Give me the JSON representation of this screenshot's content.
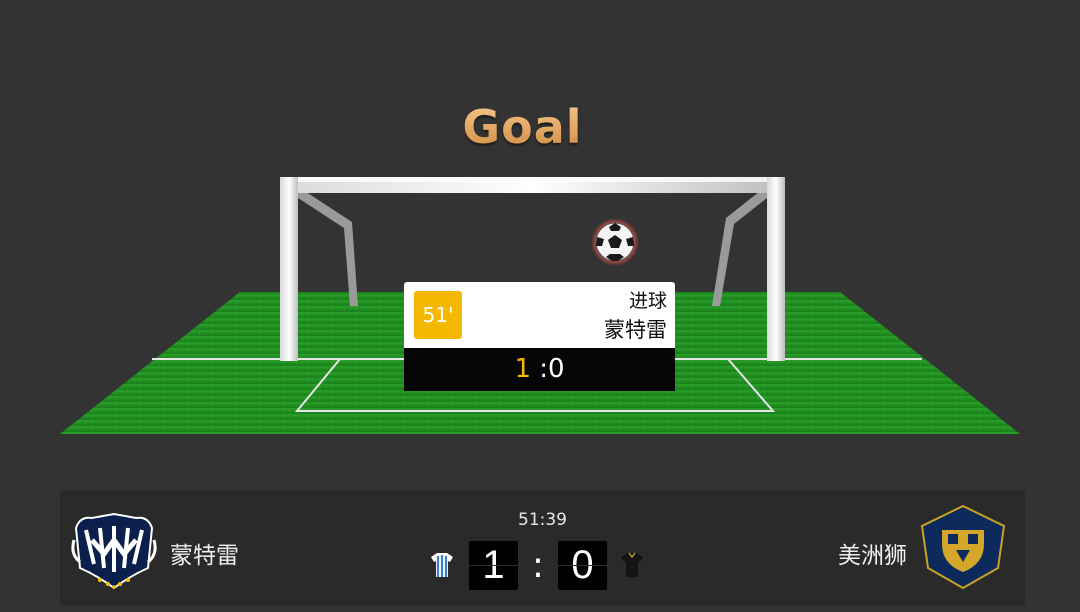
{
  "animation": {
    "title": "Goal",
    "event": {
      "minute": "51'",
      "type": "进球",
      "team": "蒙特雷",
      "score_scorer": "1",
      "score_rest": " :0"
    }
  },
  "scoreboard": {
    "clock": "51:39",
    "home": {
      "name": "蒙特雷",
      "score": "1",
      "logo": "monterrey-crest",
      "kit": "blue-white-striped-shirt"
    },
    "away": {
      "name": "美洲狮",
      "score": "0",
      "logo": "pumas-crest",
      "kit": "black-gold-shirt"
    },
    "separator": ":"
  },
  "colors": {
    "background": "#333333",
    "pitch": "#1f8f1f",
    "accent": "#f5b800",
    "title": "#e9a85a"
  }
}
